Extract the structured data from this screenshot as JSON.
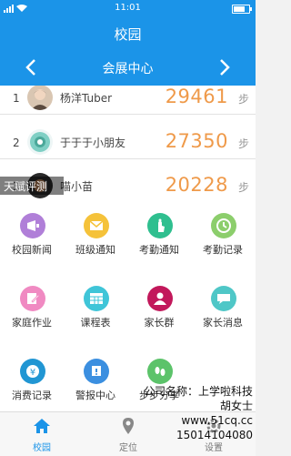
{
  "status_bar": {
    "time": "11:01"
  },
  "header": {
    "title": "校园"
  },
  "ranking": {
    "title": "会展中心",
    "rows": [
      {
        "rank": "1",
        "name": "杨洋Tuber",
        "steps": "29461",
        "unit": "步"
      },
      {
        "rank": "2",
        "name": "于于于小朋友",
        "steps": "27350",
        "unit": "步"
      },
      {
        "rank": "3",
        "name": "喵小苗",
        "steps": "20228",
        "unit": "步"
      }
    ],
    "overlay_tab": "天赋评测"
  },
  "grid": {
    "items": [
      {
        "label": "校园新闻",
        "icon": "campus-news-icon",
        "color": "#b07fd8"
      },
      {
        "label": "班级通知",
        "icon": "class-notice-icon",
        "color": "#f5c23a"
      },
      {
        "label": "考勤通知",
        "icon": "attendance-notice-icon",
        "color": "#2fbf8f"
      },
      {
        "label": "考勤记录",
        "icon": "attendance-record-icon",
        "color": "#8cce6c"
      },
      {
        "label": "家庭作业",
        "icon": "homework-icon",
        "color": "#f08ac2"
      },
      {
        "label": "课程表",
        "icon": "schedule-icon",
        "color": "#3fc5d8"
      },
      {
        "label": "家长群",
        "icon": "parent-group-icon",
        "color": "#c2185b"
      },
      {
        "label": "家长消息",
        "icon": "parent-message-icon",
        "color": "#4fc7c7"
      },
      {
        "label": "消费记录",
        "icon": "consumption-icon",
        "color": "#2196d3"
      },
      {
        "label": "警报中心",
        "icon": "alarm-icon",
        "color": "#3b8fe0"
      },
      {
        "label": "步步分享",
        "icon": "footstep-share-icon",
        "color": "#5cc36a"
      }
    ]
  },
  "tab_bar": {
    "tabs": [
      {
        "label": "校园",
        "icon": "home-icon",
        "active": true
      },
      {
        "label": "定位",
        "icon": "location-icon",
        "active": false
      },
      {
        "label": "设置",
        "icon": "gear-icon",
        "active": false
      }
    ]
  },
  "watermark": {
    "line1": "公司名称：上学啦科技",
    "line2": "胡女士",
    "line3": "www.51cq.cc",
    "line4": "15014104080"
  },
  "colors": {
    "brand": "#1b94e8",
    "steps": "#ef9a4a"
  }
}
